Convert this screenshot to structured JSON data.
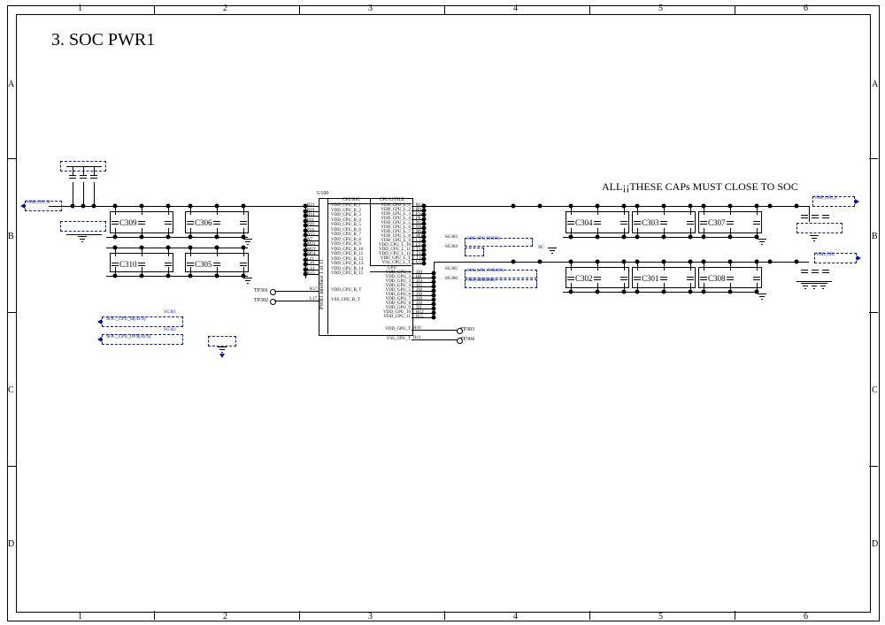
{
  "title": "3. SOC PWR1",
  "note_caps": "ALL¡¡THESE CAPs MUST CLOSE TO SOC",
  "coords_h": [
    "1",
    "2",
    "3",
    "4",
    "5",
    "6"
  ],
  "coords_v": [
    "A",
    "B",
    "C",
    "D"
  ],
  "ic": {
    "ref": "U100",
    "section": "PWR1 interface 1 of 11",
    "hdr_big": "CPU BIG",
    "hdr_little": "CPU LITTLE",
    "hdr_gpu": "GPU",
    "left_pins": [
      {
        "num": "R21",
        "name": "VDD_CPU_B_1"
      },
      {
        "num": "R19",
        "name": "VDD_CPU_B_2"
      },
      {
        "num": "R14",
        "name": "VDD_CPU_B_3"
      },
      {
        "num": "P21",
        "name": "VDD_CPU_B_4"
      },
      {
        "num": "P19",
        "name": "VDD_CPU_B_5"
      },
      {
        "num": "P14",
        "name": "VDD_CPU_B_6"
      },
      {
        "num": "N15",
        "name": "VDD_CPU_B_7"
      },
      {
        "num": "N7",
        "name": "VDD_CPU_B_8"
      },
      {
        "num": "M21",
        "name": "VDD_CPU_B_9"
      },
      {
        "num": "M19",
        "name": "VDD_CPU_B_10"
      },
      {
        "num": "M14",
        "name": "VDD_CPU_B_11"
      },
      {
        "num": "L21",
        "name": "VDD_CPU_B_12"
      },
      {
        "num": "L19",
        "name": "VDD_CPU_B_13"
      },
      {
        "num": "L14",
        "name": "VDD_CPU_B_14"
      },
      {
        "num": "K15",
        "name": "VDD_CPU_B_15"
      }
    ],
    "left_extra": [
      {
        "num": "K17",
        "name": "VDD_CPU_B_T"
      },
      {
        "num": "L17",
        "name": "VSS_CPU_B_T"
      }
    ],
    "right_pins_l": [
      {
        "num": "R12",
        "name": "VDD_CPU_L_1"
      },
      {
        "num": "R9",
        "name": "VDD_CPU_L_2"
      },
      {
        "num": "P12",
        "name": "VDD_CPU_L_3"
      },
      {
        "num": "P9",
        "name": "VDD_CPU_L_4"
      },
      {
        "num": "N12",
        "name": "VDD_CPU_L_5"
      },
      {
        "num": "N9",
        "name": "VDD_CPU_L_6"
      },
      {
        "num": "M12",
        "name": "VDD_CPU_L_7"
      },
      {
        "num": "M9",
        "name": "VDD_CPU_L_8"
      },
      {
        "num": "L12",
        "name": "VDD_CPU_L_9"
      },
      {
        "num": "L9",
        "name": "VDD_CPU_L_10"
      },
      {
        "num": "T14",
        "name": "VDD_CPU_L_11"
      },
      {
        "num": "T13",
        "name": "VDD_CPU_L_12"
      },
      {
        "num": "T15",
        "name": "VDD_CPU_L_T"
      },
      {
        "num": "U15",
        "name": "VSS_CPU_L_T"
      }
    ],
    "right_pins_g": [
      {
        "num": "J10",
        "name": "VDD_GPU_1"
      },
      {
        "num": "H8",
        "name": "VDD_GPU_2"
      },
      {
        "num": "J14",
        "name": "VDD_GPU_3"
      },
      {
        "num": "J15",
        "name": "VDD_GPU_4"
      },
      {
        "num": "J16",
        "name": "VDD_GPU_5"
      },
      {
        "num": "J18",
        "name": "VDD_GPU_6"
      },
      {
        "num": "J19",
        "name": "VDD_GPU_7"
      },
      {
        "num": "J20",
        "name": "VDD_GPU_8"
      },
      {
        "num": "J21",
        "name": "VDD_GPU_9"
      },
      {
        "num": "H12",
        "name": "VDD_GPU_10"
      },
      {
        "num": "H15",
        "name": "VDD_GPU_11"
      }
    ],
    "right_extra": [
      {
        "num": "H10",
        "name": "VDD_GPU_T"
      },
      {
        "num": "H11",
        "name": "VSS_GPU_T"
      }
    ]
  },
  "caps_left": {
    "row1": [
      "C309",
      "C306"
    ],
    "row2": [
      "C310",
      "C305"
    ]
  },
  "caps_right": {
    "row1": [
      "C304",
      "C303",
      "C307"
    ],
    "row2": [
      "C302",
      "C301",
      "C308"
    ]
  },
  "tp": {
    "left1": "TP301",
    "left2": "TP302",
    "right1": "TP303",
    "right2": "TP304"
  },
  "sg": {
    "a": "SG303",
    "b": "SG304",
    "c": "SG305",
    "d": "SG306"
  },
  "nets": {
    "vdd_cpu_b": "VDD_CPU_B",
    "soc_cpu_b": "SOC_CPU_B(AVS)",
    "soc_cpu_0v9": "SOC_CPU_0V9(AVS)",
    "soc_cpu_b_sns": "SOC_CPU_B(SNS)",
    "vdd_cpu_l": "VDD_CPU_L",
    "soc_gpu_0v9": "SOC_GPU_0V9(AVS)",
    "vdd_gpu": "VDD_GPU",
    "vss_gpu_sns": "VSS_GPU(SNS)",
    "nc": "NC"
  }
}
